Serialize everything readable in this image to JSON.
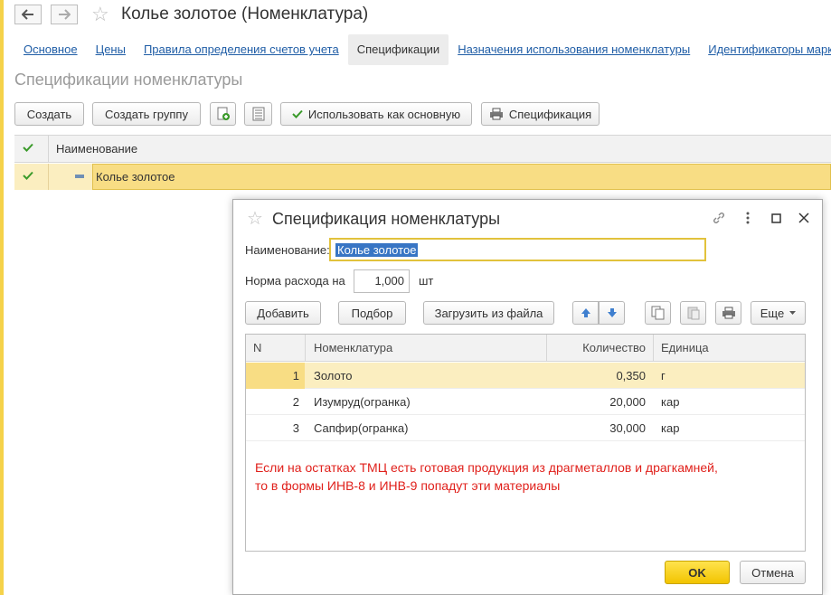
{
  "window": {
    "title": "Колье золотое (Номенклатура)"
  },
  "tabs": [
    {
      "label": "Основное"
    },
    {
      "label": "Цены"
    },
    {
      "label": "Правила определения счетов учета"
    },
    {
      "label": "Спецификации"
    },
    {
      "label": "Назначения использования номенклатуры"
    },
    {
      "label": "Идентификаторы маркет"
    }
  ],
  "active_tab": "Спецификации",
  "section_title": "Спецификации номенклатуры",
  "toolbar": {
    "create": "Создать",
    "create_group": "Создать группу",
    "use_as_main": "Использовать как основную",
    "specification": "Спецификация"
  },
  "list": {
    "column_name": "Наименование",
    "rows": [
      {
        "name": "Колье золотое"
      }
    ]
  },
  "dialog": {
    "title": "Спецификация номенклатуры",
    "name_label": "Наименование:",
    "name_value": "Колье золотое",
    "norm_label": "Норма расхода на",
    "norm_value": "1,000",
    "norm_unit": "шт",
    "toolbar": {
      "add": "Добавить",
      "pick": "Подбор",
      "load_file": "Загрузить из файла",
      "more": "Еще"
    },
    "table": {
      "columns": [
        "N",
        "Номенклатура",
        "Количество",
        "Единица"
      ],
      "rows": [
        {
          "n": "1",
          "item": "Золото",
          "qty": "0,350",
          "unit": "г"
        },
        {
          "n": "2",
          "item": "Изумруд(огранка)",
          "qty": "20,000",
          "unit": "кар"
        },
        {
          "n": "3",
          "item": "Сапфир(огранка)",
          "qty": "30,000",
          "unit": "кар"
        }
      ]
    },
    "note_line1": "Если на остатках ТМЦ есть готовая продукция из драгметаллов и драгкамней,",
    "note_line2": "то в формы ИНВ-8 и ИНВ-9 попадут эти материалы",
    "ok": "OK",
    "cancel": "Отмена"
  },
  "colors": {
    "accent_yellow": "#f2c400",
    "selection_row": "#fbeec0",
    "link_blue": "#1f5da6",
    "note_red": "#e0201b",
    "check_green": "#3a9a2a"
  }
}
